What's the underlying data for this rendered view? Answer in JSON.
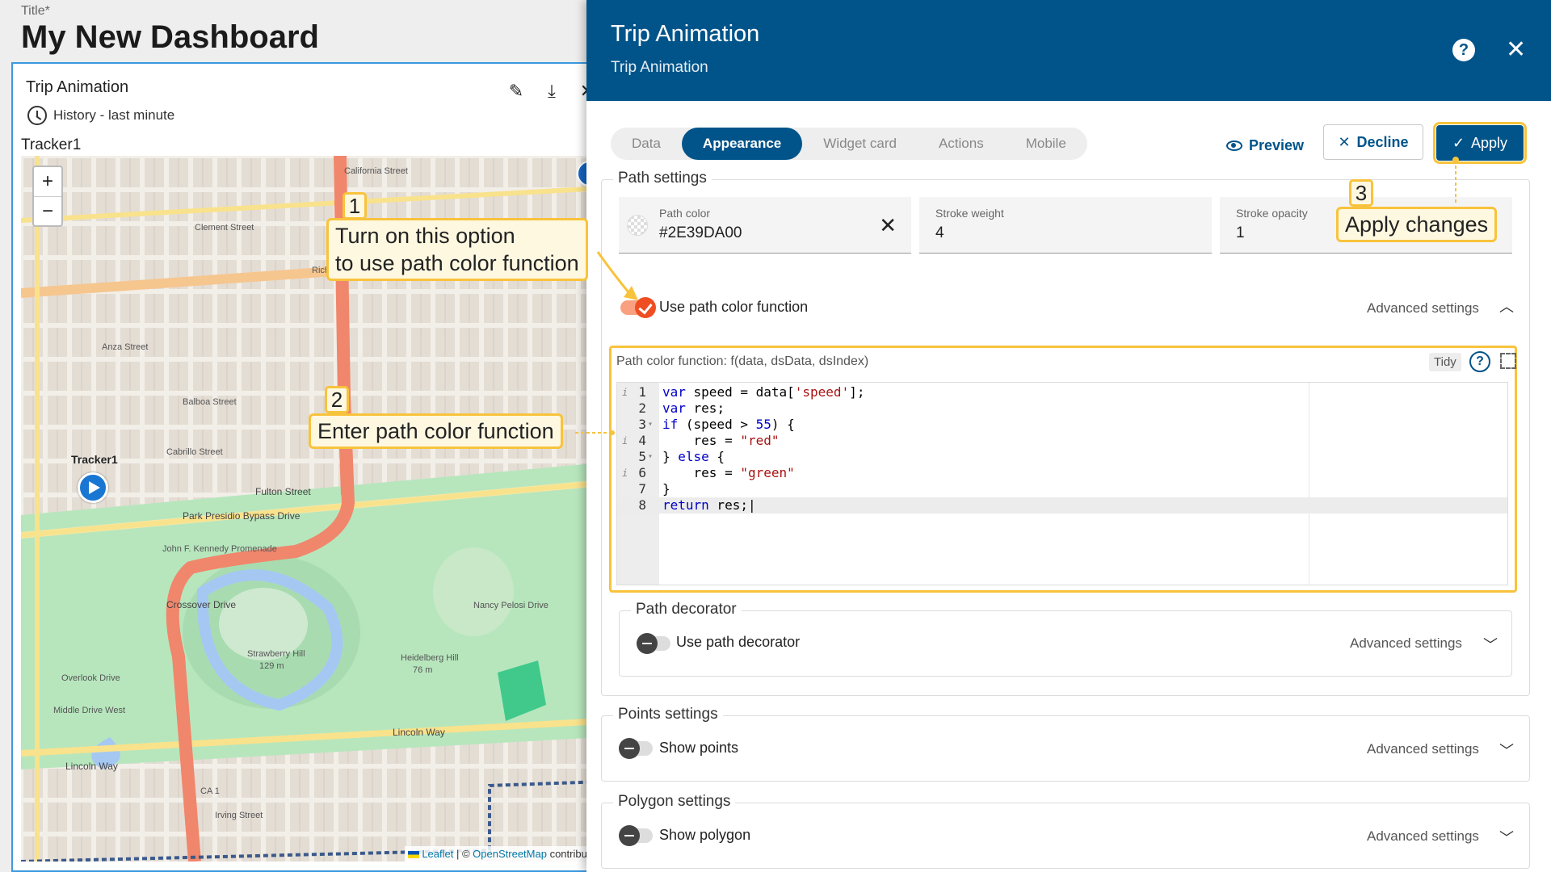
{
  "dashboard": {
    "title_label": "Title*",
    "title": "My New Dashboard",
    "widget": {
      "title": "Trip Animation",
      "timewindow": "History - last minute",
      "tracker_label": "Tracker1",
      "icons": [
        "edit-icon",
        "download-icon",
        "close-icon"
      ],
      "map": {
        "zoom_in": "+",
        "zoom_out": "−",
        "info": "i",
        "marker_label": "Tracker1",
        "attribution": {
          "leaflet": "Leaflet",
          "separator": " | © ",
          "osm": "OpenStreetMap",
          "suffix": " contributor"
        },
        "labels": {
          "california": "California Street",
          "clement": "Clement Street",
          "richmond": "Richmond District",
          "anza": "Anza Street",
          "balboa": "Balboa Street",
          "cabrillo": "Cabrillo Street",
          "fulton": "Fulton Street",
          "park_presidio": "Park Presidio Bypass Drive",
          "jfk": "John F. Kennedy Promenade",
          "crossover": "Crossover Drive",
          "strawberry": "Strawberry Hill",
          "strawberry_h": "129 m",
          "heidelberg": "Heidelberg Hill",
          "heidelberg_h": "76 m",
          "lincoln_l": "Lincoln Way",
          "lincoln_r": "Lincoln Way",
          "irving": "Irving Street",
          "nancy": "Nancy Pelosi Drive",
          "middle": "Middle Drive West",
          "overlook": "Overlook Drive",
          "ca1": "CA 1"
        }
      }
    }
  },
  "callouts": {
    "c1_num": "1",
    "c1_line1": "Turn on this option",
    "c1_line2": "to use path color function",
    "c2_num": "2",
    "c2_text": "Enter path color function",
    "c3_num": "3",
    "c3_text": "Apply changes"
  },
  "panel": {
    "title": "Trip Animation",
    "subtitle": "Trip Animation",
    "tabs": [
      {
        "label": "Data",
        "active": false
      },
      {
        "label": "Appearance",
        "active": true
      },
      {
        "label": "Widget card",
        "active": false
      },
      {
        "label": "Actions",
        "active": false
      },
      {
        "label": "Mobile",
        "active": false
      }
    ],
    "preview_label": "Preview",
    "decline_label": "Decline",
    "apply_label": "Apply",
    "path_settings": {
      "legend": "Path settings",
      "path_color_label": "Path color",
      "path_color_value": "#2E39DA00",
      "stroke_weight_label": "Stroke weight",
      "stroke_weight_value": "4",
      "stroke_opacity_label": "Stroke opacity",
      "stroke_opacity_value": "1",
      "use_function_label": "Use path color function",
      "use_function_on": true,
      "advanced": "Advanced settings",
      "function_label": "Path color function: f(data, dsData, dsIndex)",
      "tidy": "Tidy",
      "code": [
        {
          "n": "1",
          "text": "var speed = data['speed'];"
        },
        {
          "n": "2",
          "text": "var res;"
        },
        {
          "n": "3",
          "text": "if (speed > 55) {"
        },
        {
          "n": "4",
          "text": "    res = \"red\""
        },
        {
          "n": "5",
          "text": "} else {"
        },
        {
          "n": "6",
          "text": "    res = \"green\""
        },
        {
          "n": "7",
          "text": "}"
        },
        {
          "n": "8",
          "text": "return res;"
        }
      ]
    },
    "path_decorator": {
      "legend": "Path decorator",
      "toggle_label": "Use path decorator",
      "advanced": "Advanced settings"
    },
    "points_settings": {
      "legend": "Points settings",
      "toggle_label": "Show points",
      "advanced": "Advanced settings"
    },
    "polygon_settings": {
      "legend": "Polygon settings",
      "toggle_label": "Show polygon",
      "advanced": "Advanced settings"
    }
  },
  "colors": {
    "header": "#00548a",
    "callout_border": "#f8c33c",
    "toggle_on": "#ef4e22",
    "route": "#f0866b"
  }
}
